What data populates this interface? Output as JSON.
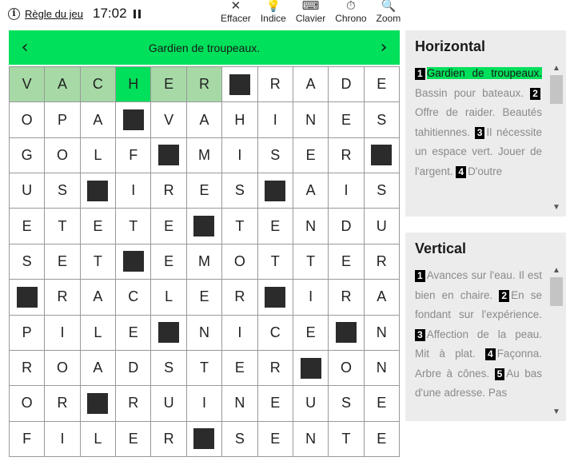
{
  "header": {
    "rules_label": "Règle du jeu",
    "timer": "17:02",
    "tools": [
      {
        "label": "Effacer",
        "icon": "close-icon",
        "glyph": "✕"
      },
      {
        "label": "Indice",
        "icon": "lightbulb-icon",
        "glyph": "💡"
      },
      {
        "label": "Clavier",
        "icon": "keyboard-icon",
        "glyph": "⌨"
      },
      {
        "label": "Chrono",
        "icon": "stopwatch-icon",
        "glyph": "⏱"
      },
      {
        "label": "Zoom",
        "icon": "zoom-icon",
        "glyph": "🔍"
      }
    ]
  },
  "clue_bar": {
    "text": "Gardien de troupeaux.",
    "prev": "‹",
    "next": "›"
  },
  "grid": {
    "rows": [
      [
        "V",
        "A",
        "C",
        "H",
        "E",
        "R",
        "#",
        "R",
        "A",
        "D",
        "E"
      ],
      [
        "O",
        "P",
        "A",
        "#",
        "V",
        "A",
        "H",
        "I",
        "N",
        "E",
        "S"
      ],
      [
        "G",
        "O",
        "L",
        "F",
        "#",
        "M",
        "I",
        "S",
        "E",
        "R",
        "#"
      ],
      [
        "U",
        "S",
        "#",
        "I",
        "R",
        "E",
        "S",
        "#",
        "A",
        "I",
        "S"
      ],
      [
        "E",
        "T",
        "E",
        "T",
        "E",
        "#",
        "T",
        "E",
        "N",
        "D",
        "U"
      ],
      [
        "S",
        "E",
        "T",
        "#",
        "E",
        "M",
        "O",
        "T",
        "T",
        "E",
        "R"
      ],
      [
        "#",
        "R",
        "A",
        "C",
        "L",
        "E",
        "R",
        "#",
        "I",
        "R",
        "A"
      ],
      [
        "P",
        "I",
        "L",
        "E",
        "#",
        "N",
        "I",
        "C",
        "E",
        "#",
        "N"
      ],
      [
        "R",
        "O",
        "A",
        "D",
        "S",
        "T",
        "E",
        "R",
        "#",
        "O",
        "N"
      ],
      [
        "O",
        "R",
        "#",
        "R",
        "U",
        "I",
        "N",
        "E",
        "U",
        "S",
        "E"
      ],
      [
        "F",
        "I",
        "L",
        "E",
        "R",
        "#",
        "S",
        "E",
        "N",
        "T",
        "E"
      ]
    ],
    "highlight_row": 0,
    "highlight_cols": [
      0,
      1,
      2,
      3,
      4,
      5
    ],
    "current_col": 3
  },
  "horizontal": {
    "title": "Horizontal",
    "clues": [
      {
        "num": "1",
        "text": "Gardien de troupeaux.",
        "active": true
      },
      {
        "num": "",
        "text": "Bassin pour bateaux.",
        "active": false
      },
      {
        "num": "2",
        "text": "Offre de raider. Beautés tahitiennes.",
        "active": false
      },
      {
        "num": "3",
        "text": "Il nécessite un espace vert. Jouer de l'argent.",
        "active": false
      },
      {
        "num": "4",
        "text": "D'outre",
        "active": false
      }
    ]
  },
  "vertical": {
    "title": "Vertical",
    "clues": [
      {
        "num": "1",
        "text": "Avances sur l'eau. Il est bien en chaire.",
        "active": false
      },
      {
        "num": "2",
        "text": "En se fondant sur l'expérience.",
        "active": false
      },
      {
        "num": "3",
        "text": "Affection de la peau. Mit à plat.",
        "active": false
      },
      {
        "num": "4",
        "text": "Façonna. Arbre à cônes.",
        "active": false
      },
      {
        "num": "5",
        "text": "Au bas d'une adresse. Pas",
        "active": false
      }
    ]
  },
  "colors": {
    "accent": "#00e05a",
    "highlight": "#a6d9a6",
    "block": "#2b2b2b",
    "panel": "#ececec"
  }
}
